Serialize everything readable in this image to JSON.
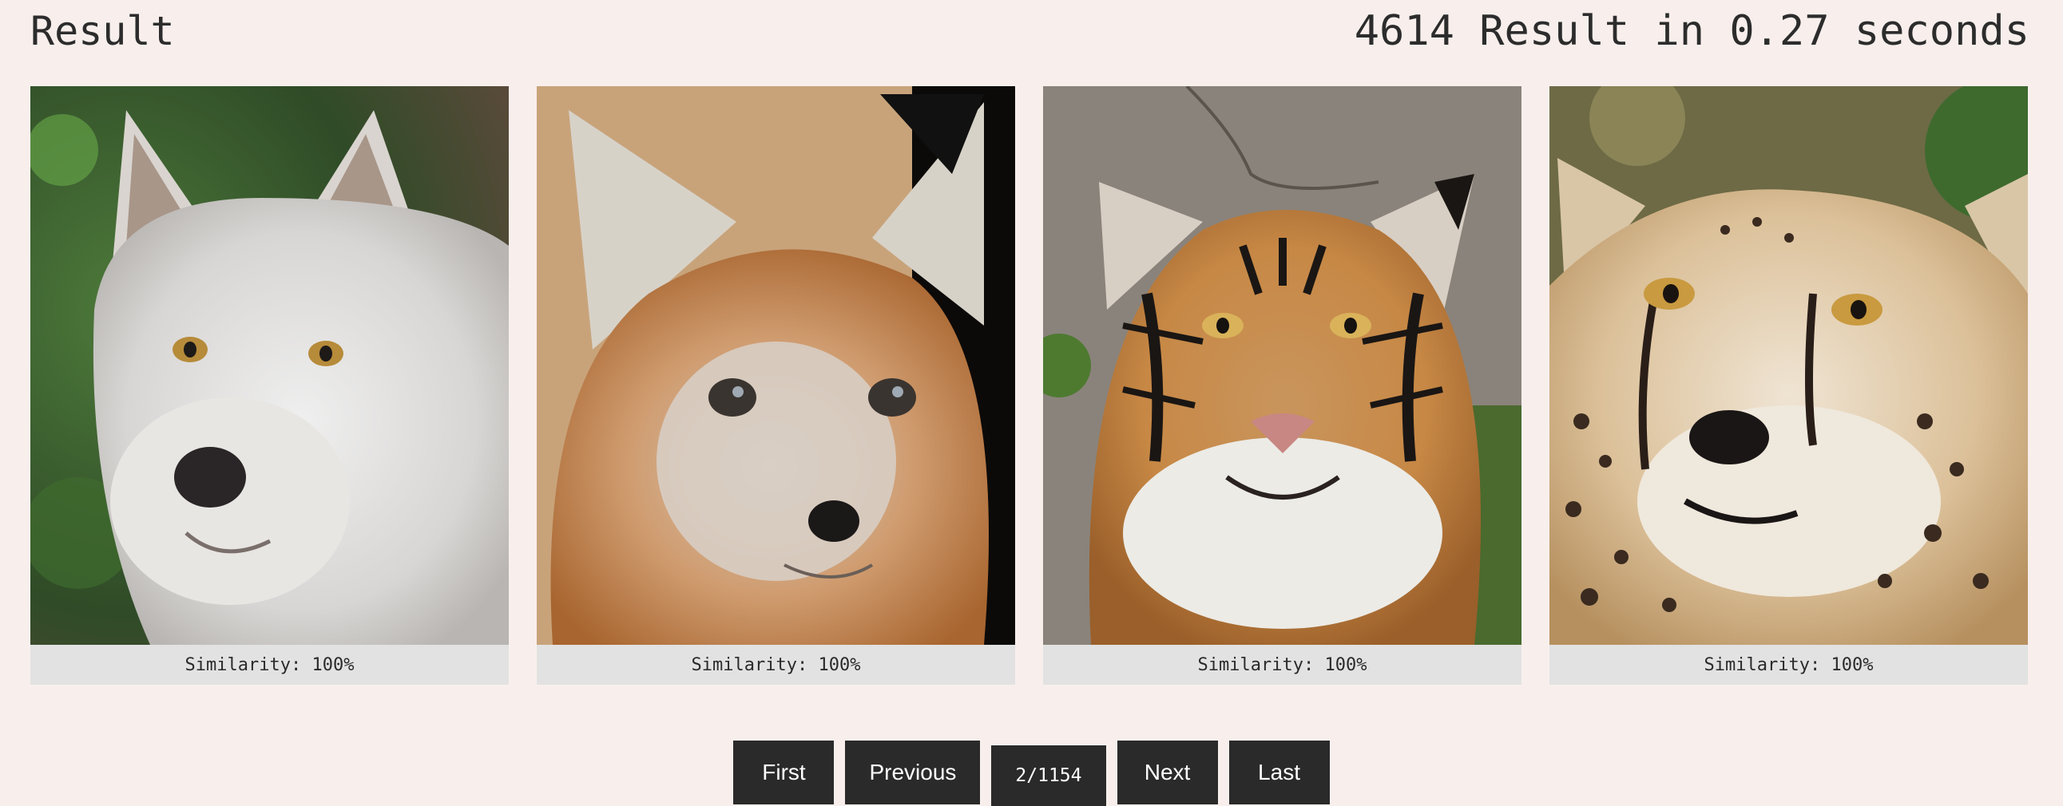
{
  "header": {
    "title": "Result",
    "stats": "4614 Result in 0.27 seconds"
  },
  "results": [
    {
      "animal": "wolf",
      "caption": "Similarity: 100%"
    },
    {
      "animal": "fox",
      "caption": "Similarity: 100%"
    },
    {
      "animal": "tiger",
      "caption": "Similarity: 100%"
    },
    {
      "animal": "cheetah",
      "caption": "Similarity: 100%"
    }
  ],
  "pagination": {
    "first_label": "First",
    "previous_label": "Previous",
    "current_page": "2/1154",
    "next_label": "Next",
    "last_label": "Last"
  },
  "colors": {
    "background": "#f8efec",
    "caption_bg": "#e2e2e2",
    "button_bg": "#2a2a2a",
    "button_text": "#ffffff"
  }
}
